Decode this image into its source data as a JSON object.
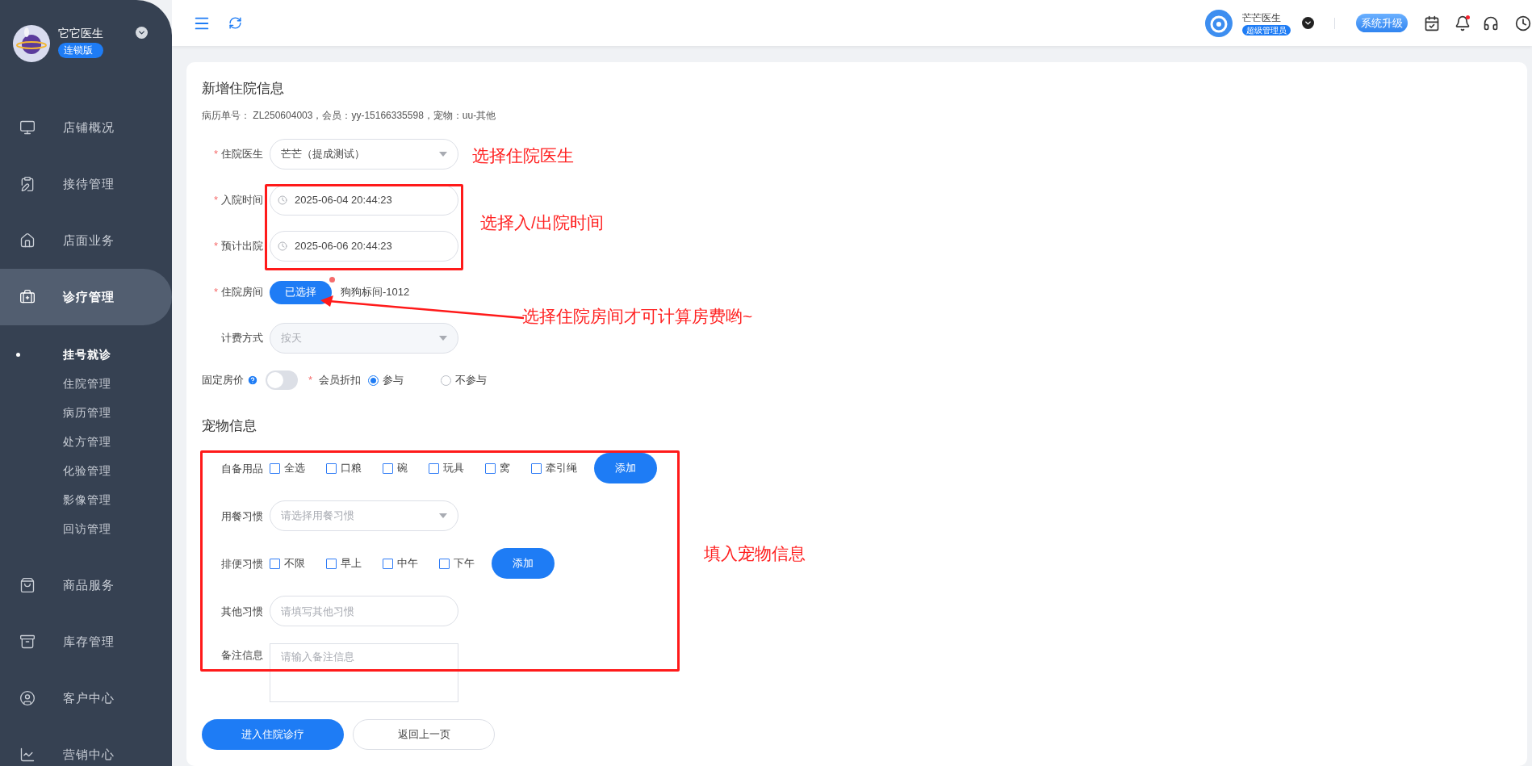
{
  "sidebar": {
    "brand": {
      "name": "它它医生",
      "badge": "连锁版"
    },
    "items": [
      {
        "label": "店铺概况",
        "selected": false
      },
      {
        "label": "接待管理",
        "selected": false
      },
      {
        "label": "店面业务",
        "selected": false
      },
      {
        "label": "诊疗管理",
        "selected": true,
        "children": [
          {
            "label": "挂号就诊",
            "selected": true
          },
          {
            "label": "住院管理",
            "selected": false
          },
          {
            "label": "病历管理",
            "selected": false
          },
          {
            "label": "处方管理",
            "selected": false
          },
          {
            "label": "化验管理",
            "selected": false
          },
          {
            "label": "影像管理",
            "selected": false
          },
          {
            "label": "回访管理",
            "selected": false
          }
        ]
      },
      {
        "label": "商品服务",
        "selected": false
      },
      {
        "label": "库存管理",
        "selected": false
      },
      {
        "label": "客户中心",
        "selected": false
      },
      {
        "label": "营销中心",
        "selected": false
      }
    ]
  },
  "topbar": {
    "user": {
      "name": "芒芒医生",
      "role": "超级管理员"
    },
    "upgrade_button": "系统升级",
    "bell_dot": true
  },
  "form": {
    "title": "新增住院信息",
    "info": "病历单号： ZL250604003，会员：yy-15166335598，宠物：uu-其他",
    "rows": [
      {
        "kind": "select",
        "label": "住院医生",
        "required": "*",
        "value": "芒芒（提成测试）",
        "disabled": false
      },
      {
        "kind": "datetime",
        "label": "入院时间",
        "required": "*",
        "value": "2025-06-04 20:44:23"
      },
      {
        "kind": "datetime",
        "label": "预计出院",
        "required": "*",
        "value": "2025-06-06 20:44:23"
      },
      {
        "kind": "room",
        "label": "住院房间",
        "required": "*",
        "button": "已选择",
        "dot": true,
        "value": "狗狗标间-1012"
      },
      {
        "kind": "select",
        "label": "计费方式",
        "value": "按天",
        "disabled": true
      }
    ],
    "fixed_price": {
      "label": "固定房价",
      "on": false
    },
    "discount": {
      "label": "会员折扣",
      "required": "*",
      "options": [
        {
          "label": "参与",
          "selected": true
        },
        {
          "label": "不参与",
          "selected": false
        }
      ]
    }
  },
  "pet": {
    "title": "宠物信息",
    "rows": [
      {
        "kind": "checkboxes",
        "label": "自备用品",
        "options": [
          {
            "label": "全选",
            "checked": false
          },
          {
            "label": "口粮",
            "checked": false
          },
          {
            "label": "碗",
            "checked": false
          },
          {
            "label": "玩具",
            "checked": false
          },
          {
            "label": "窝",
            "checked": false
          },
          {
            "label": "牵引绳",
            "checked": false
          }
        ],
        "button": "添加"
      },
      {
        "kind": "select",
        "label": "用餐习惯",
        "placeholder": "请选择用餐习惯"
      },
      {
        "kind": "checkboxes",
        "label": "排便习惯",
        "options": [
          {
            "label": "不限",
            "checked": false
          },
          {
            "label": "早上",
            "checked": false
          },
          {
            "label": "中午",
            "checked": false
          },
          {
            "label": "下午",
            "checked": false
          }
        ],
        "button": "添加"
      },
      {
        "kind": "input",
        "label": "其他习惯",
        "placeholder": "请填写其他习惯"
      },
      {
        "kind": "textarea",
        "label": "备注信息",
        "placeholder": "请输入备注信息"
      }
    ]
  },
  "actions": [
    {
      "label": "进入住院诊疗",
      "kind": "primary"
    },
    {
      "label": "返回上一页",
      "kind": "secondary"
    }
  ],
  "annotations": {
    "doctor_note": "选择住院医生",
    "time_note": "选择入/出院时间",
    "room_note": "选择住院房间才可计算房费哟~",
    "pet_note": "填入宠物信息"
  }
}
